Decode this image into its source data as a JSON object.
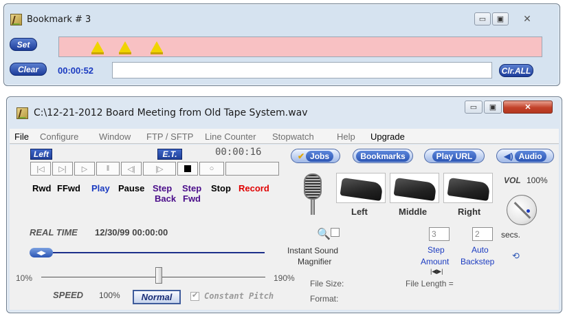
{
  "bookmark_window": {
    "title": "Bookmark # 3",
    "set_label": "Set",
    "clear_label": "Clear",
    "time": "00:00:52",
    "clear_all_label": "Clr.ALL",
    "text_value": ""
  },
  "main_window": {
    "title": "C:\\12-21-2012 Board Meeting from Old Tape System.wav",
    "menu": [
      "File",
      "Configure",
      "Window",
      "FTP / SFTP",
      "Line Counter",
      "Stopwatch",
      "Help",
      "Upgrade"
    ],
    "left_tag": "Left",
    "et_tag": "E.T.",
    "et_counter": "00:00:16",
    "transport": {
      "rwd": "Rwd",
      "ffwd": "FFwd",
      "play": "Play",
      "pause": "Pause",
      "step_back_1": "Step",
      "step_back_2": "Back",
      "step_fwd_1": "Step",
      "step_fwd_2": "Fwd",
      "stop": "Stop",
      "record": "Record"
    },
    "pills": {
      "jobs": "Jobs",
      "bookmarks": "Bookmarks",
      "play_url": "Play URL",
      "audio": "Audio"
    },
    "pedals": {
      "left": "Left",
      "middle": "Middle",
      "right": "Right"
    },
    "volume": {
      "label": "VOL",
      "value": "100%"
    },
    "real_time": {
      "label": "REAL TIME",
      "value": "12/30/99 00:00:00"
    },
    "magnifier": {
      "line1": "Instant Sound",
      "line2": "Magnifier"
    },
    "step_amount": {
      "value": "3",
      "line1": "Step",
      "line2": "Amount"
    },
    "auto_backstep": {
      "value": "2",
      "line1": "Auto",
      "line2": "Backstep",
      "unit": "secs."
    },
    "speed": {
      "min": "10%",
      "max": "190%",
      "label": "SPEED",
      "value": "100%",
      "normal_label": "Normal",
      "constant_pitch": "Constant Pitch"
    },
    "file_info": {
      "file_size": "File Size:",
      "format": "Format:",
      "file_length": "File Length ="
    }
  },
  "colors": {
    "bookmark_strip": "#f8c1c3",
    "marker": "#f0d400",
    "accent_blue": "#1a3ac0",
    "record_red": "#e00000"
  }
}
